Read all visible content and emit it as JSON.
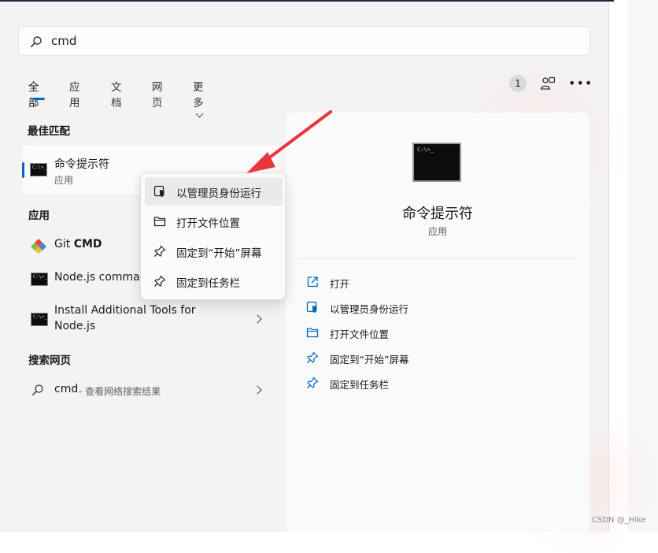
{
  "search": {
    "value": "cmd"
  },
  "tabs": [
    {
      "label": "全部"
    },
    {
      "label": "应用"
    },
    {
      "label": "文档"
    },
    {
      "label": "网页"
    },
    {
      "label": "更多"
    }
  ],
  "header_right": {
    "count": "1"
  },
  "best_match": {
    "section": "最佳匹配",
    "title": "命令提示符",
    "subtitle": "应用"
  },
  "apps": {
    "section": "应用",
    "items": [
      {
        "prefix": "Git ",
        "title_bold": "CMD"
      },
      {
        "title": "Node.js command prompt"
      },
      {
        "title_line1": "Install Additional Tools for",
        "title_line2": "Node.js"
      }
    ]
  },
  "web": {
    "section": "搜索网页",
    "query": "cmd",
    "hint": " - 查看网络搜索结果"
  },
  "context_menu": [
    {
      "label": "以管理员身份运行",
      "icon": "shield-icon"
    },
    {
      "label": "打开文件位置",
      "icon": "folder-icon"
    },
    {
      "label": "固定到“开始”屏幕",
      "icon": "pin-icon"
    },
    {
      "label": "固定到任务栏",
      "icon": "pin-icon"
    }
  ],
  "detail": {
    "title": "命令提示符",
    "subtitle": "应用",
    "actions": [
      {
        "label": "打开",
        "icon": "open-external-icon"
      },
      {
        "label": "以管理员身份运行",
        "icon": "shield-icon"
      },
      {
        "label": "打开文件位置",
        "icon": "folder-icon"
      },
      {
        "label": "固定到“开始”屏幕",
        "icon": "pin-icon"
      },
      {
        "label": "固定到任务栏",
        "icon": "pin-icon"
      }
    ]
  },
  "cmd_icon_text": "C:\\>_",
  "watermark": "CSDN @_Hike",
  "colors": {
    "accent": "#0067c0",
    "annotation_arrow": "#e8363a"
  }
}
